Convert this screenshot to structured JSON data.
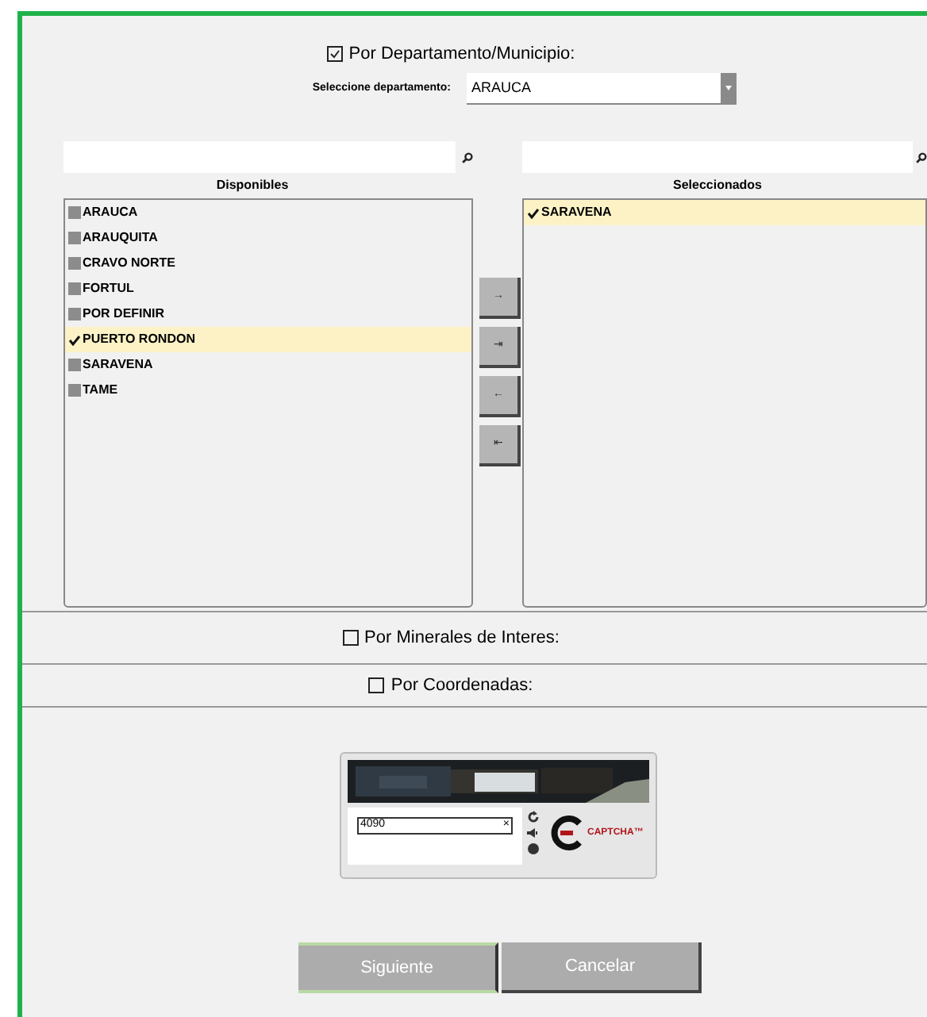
{
  "sections": [
    {
      "label": "Por Departamento/Municipio:",
      "checked": true
    },
    {
      "label": "Por Minerales de Interes:",
      "checked": false
    },
    {
      "label": "Por Coordenadas:",
      "checked": false
    }
  ],
  "department": {
    "label": "Seleccione departamento:",
    "value": "ARAUCA"
  },
  "available": {
    "title": "Disponibles",
    "items": [
      {
        "label": "ARAUCA",
        "selected": false
      },
      {
        "label": "ARAUQUITA",
        "selected": false
      },
      {
        "label": "CRAVO NORTE",
        "selected": false
      },
      {
        "label": "FORTUL",
        "selected": false
      },
      {
        "label": "POR DEFINIR",
        "selected": false
      },
      {
        "label": "PUERTO RONDON",
        "selected": true
      },
      {
        "label": "SARAVENA",
        "selected": false
      },
      {
        "label": "TAME",
        "selected": false
      }
    ]
  },
  "chosen": {
    "title": "Seleccionados",
    "items": [
      {
        "label": "SARAVENA",
        "selected": true
      }
    ]
  },
  "move_buttons": [
    "→",
    "⇥",
    "←",
    "⇤"
  ],
  "captcha": {
    "value": "4090",
    "clear": "×",
    "logo": "CAPTCHA™"
  },
  "buttons": [
    {
      "label": "Siguiente",
      "kind": "primary"
    },
    {
      "label": "Cancelar",
      "kind": "secondary"
    }
  ]
}
